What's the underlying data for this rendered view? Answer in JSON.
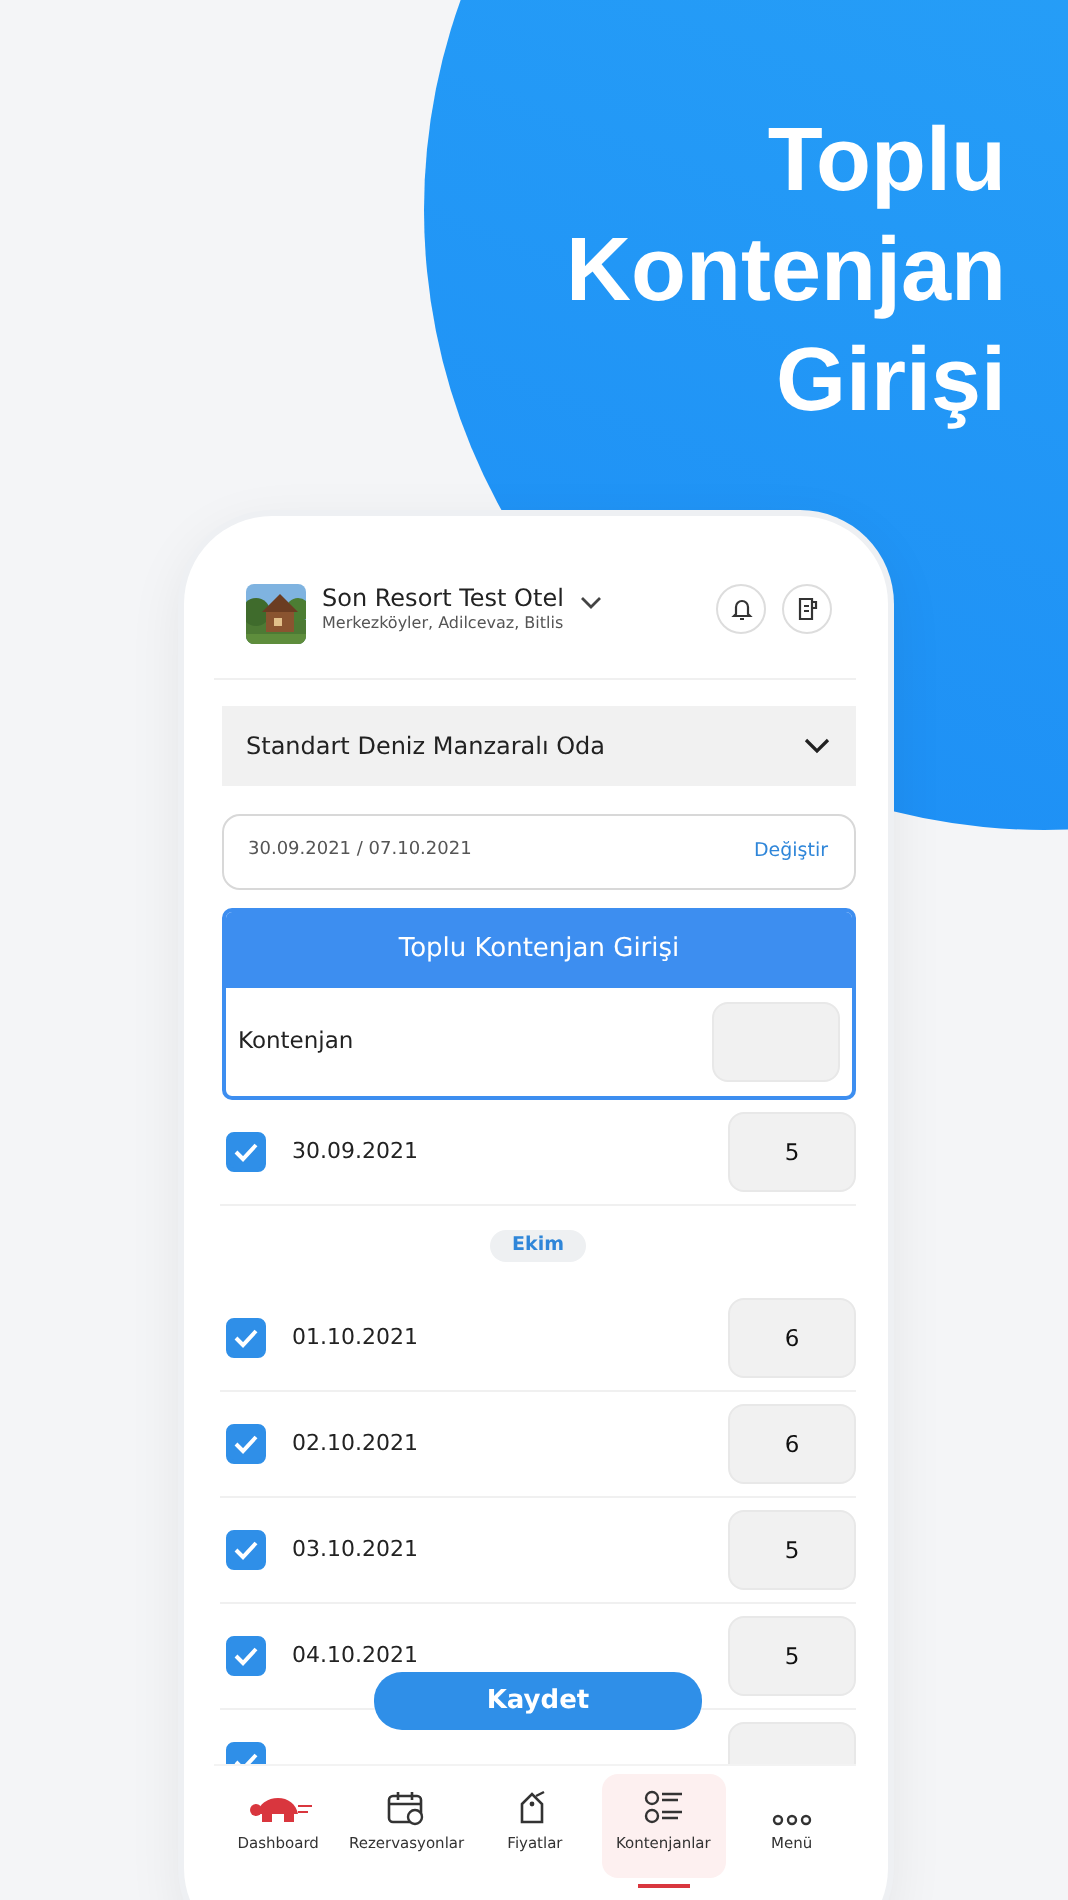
{
  "headline": [
    "Toplu",
    "Kontenjan",
    "Girişi"
  ],
  "hotel": {
    "name": "Son Resort Test Otel",
    "address": "Merkezköyler, Adilcevaz, Bitlis"
  },
  "room_select": {
    "value": "Standart  Deniz Manzaralı Oda"
  },
  "date_range": {
    "value": "30.09.2021 / 07.10.2021",
    "action": "Değiştir"
  },
  "bulk_panel": {
    "title": "Toplu Kontenjan Girişi",
    "label": "Kontenjan"
  },
  "days": [
    {
      "kind": "day",
      "date": "30.09.2021",
      "checked": true,
      "value": "5"
    },
    {
      "kind": "month",
      "label": "Ekim"
    },
    {
      "kind": "day",
      "date": "01.10.2021",
      "checked": true,
      "value": "6"
    },
    {
      "kind": "day",
      "date": "02.10.2021",
      "checked": true,
      "value": "6"
    },
    {
      "kind": "day",
      "date": "03.10.2021",
      "checked": true,
      "value": "5"
    },
    {
      "kind": "day",
      "date": "04.10.2021",
      "checked": true,
      "value": "5"
    },
    {
      "kind": "day",
      "checked": true
    }
  ],
  "save_button": "Kaydet",
  "bottom_nav": [
    {
      "label": "Dashboard",
      "selected": false
    },
    {
      "label": "Rezervasyonlar",
      "selected": false
    },
    {
      "label": "Fiyatlar",
      "selected": false
    },
    {
      "label": "Kontenjanlar",
      "selected": true
    },
    {
      "label": "Menü",
      "selected": false
    }
  ]
}
